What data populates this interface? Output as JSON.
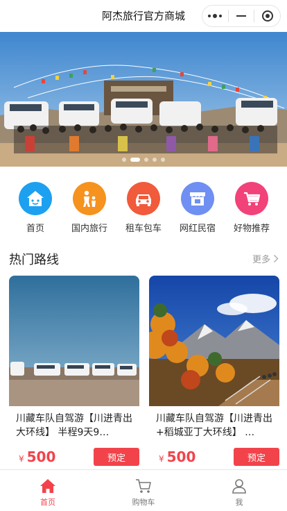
{
  "header": {
    "title": "阿杰旅行官方商城"
  },
  "capsule": {
    "menu_icon": "more-dots-icon",
    "minimize_icon": "minus-icon",
    "close_icon": "target-circle-icon"
  },
  "banner": {
    "image": "travel-group-photo-with-suvs",
    "slide_count": 5,
    "active_slide": 2
  },
  "categories": [
    {
      "label": "首页",
      "icon": "home-face-icon",
      "color": "#1ea0f0"
    },
    {
      "label": "国内旅行",
      "icon": "family-icon",
      "color": "#f6921e"
    },
    {
      "label": "租车包车",
      "icon": "car-icon",
      "color": "#f15a3a"
    },
    {
      "label": "网红民宿",
      "icon": "shop-icon",
      "color": "#6f8ff2"
    },
    {
      "label": "好物推荐",
      "icon": "cart-icon",
      "color": "#f2427a"
    }
  ],
  "section": {
    "title": "热门路线",
    "more": "更多"
  },
  "products": [
    {
      "name": "川藏车队自驾游【川进青出大环线】 半程9天9…",
      "currency": "¥",
      "price": "500",
      "button": "预定",
      "image": "suv-convoy-plateau"
    },
    {
      "name": "川藏车队自驾游【川进青出+稻城亚丁大环线】 …",
      "currency": "¥",
      "price": "500",
      "button": "预定",
      "image": "autumn-mountains-boardwalk"
    }
  ],
  "tabbar": [
    {
      "label": "首页",
      "icon": "home-icon",
      "active": true
    },
    {
      "label": "购物车",
      "icon": "cart-outline-icon",
      "active": false
    },
    {
      "label": "我",
      "icon": "user-icon",
      "active": false
    }
  ],
  "colors": {
    "accent": "#f2434b",
    "tab_inactive": "#777777"
  }
}
